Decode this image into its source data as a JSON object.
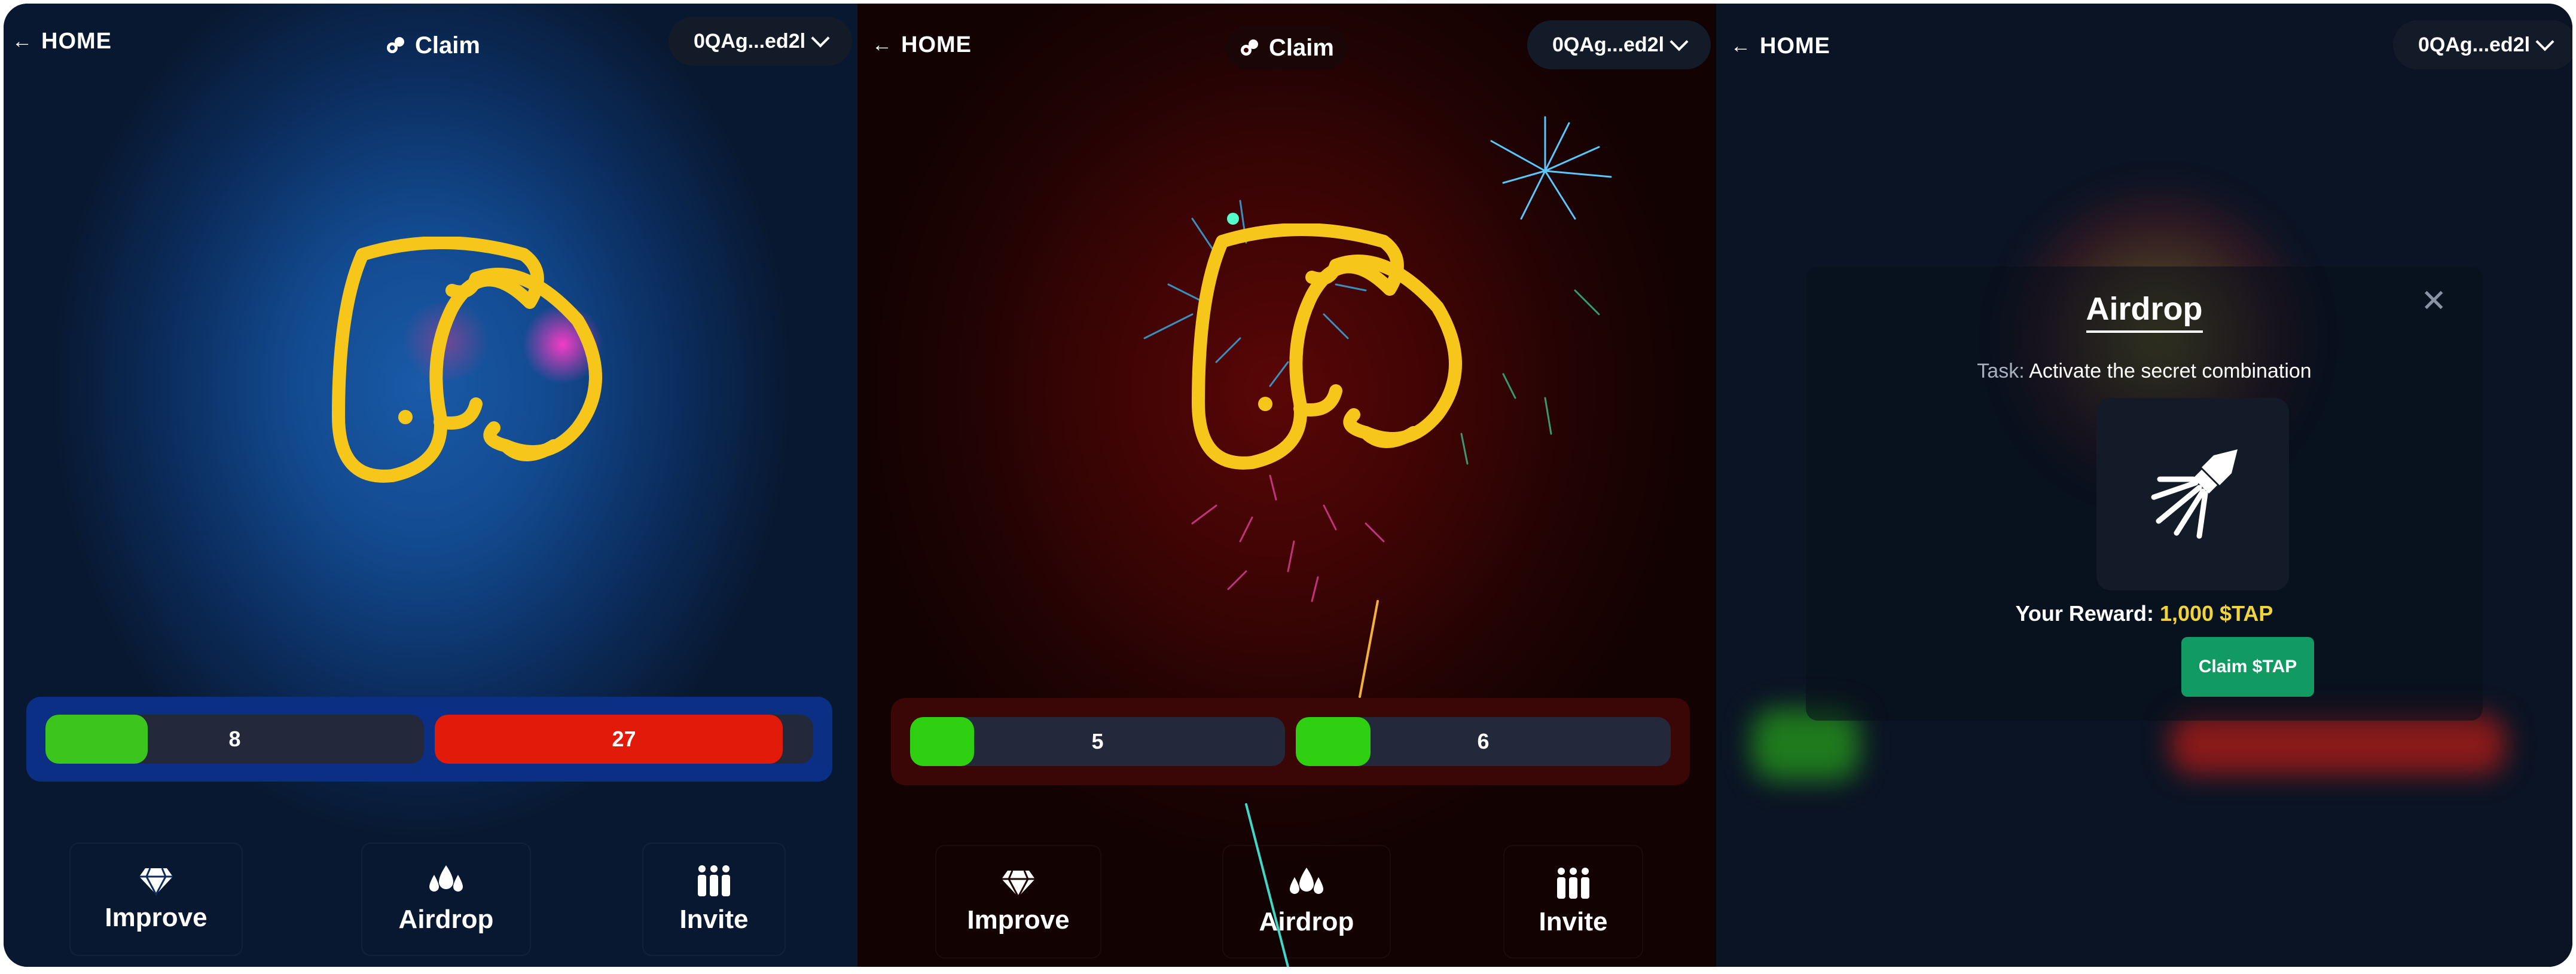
{
  "colors": {
    "accent_yellow": "#f7c61b",
    "green": "#3cc51d",
    "red": "#e21a0a",
    "claim_green": "#119a62",
    "reward_yellow": "#f0d43a"
  },
  "panels": [
    {
      "home_label": "HOME",
      "claim_label": "Claim",
      "wallet": "0QAg...ed2l",
      "bars": [
        {
          "value": "8",
          "fill_fraction": 0.27,
          "color": "#3cc51d"
        },
        {
          "value": "27",
          "fill_fraction": 0.92,
          "color": "#e21a0a"
        }
      ],
      "nav": [
        {
          "label": "Improve",
          "icon": "diamond-icon"
        },
        {
          "label": "Airdrop",
          "icon": "drops-icon"
        },
        {
          "label": "Invite",
          "icon": "people-icon"
        }
      ]
    },
    {
      "home_label": "HOME",
      "claim_label": "Claim",
      "wallet": "0QAg...ed2l",
      "bars": [
        {
          "value": "5",
          "fill_fraction": 0.17,
          "color": "#3cc51d"
        },
        {
          "value": "6",
          "fill_fraction": 0.2,
          "color": "#3cc51d"
        }
      ],
      "nav": [
        {
          "label": "Improve",
          "icon": "diamond-icon"
        },
        {
          "label": "Airdrop",
          "icon": "drops-icon"
        },
        {
          "label": "Invite",
          "icon": "people-icon"
        }
      ]
    },
    {
      "home_label": "HOME",
      "wallet": "0QAg...ed2l",
      "modal": {
        "title": "Airdrop",
        "task_key": "Task:",
        "task_value": "Activate the secret combination",
        "reward_key": "Your Reward:",
        "reward_value": "1,000 $TAP",
        "claim_button": "Claim $TAP",
        "icon": "firework-rocket-icon",
        "close_icon": "close-icon"
      }
    }
  ]
}
